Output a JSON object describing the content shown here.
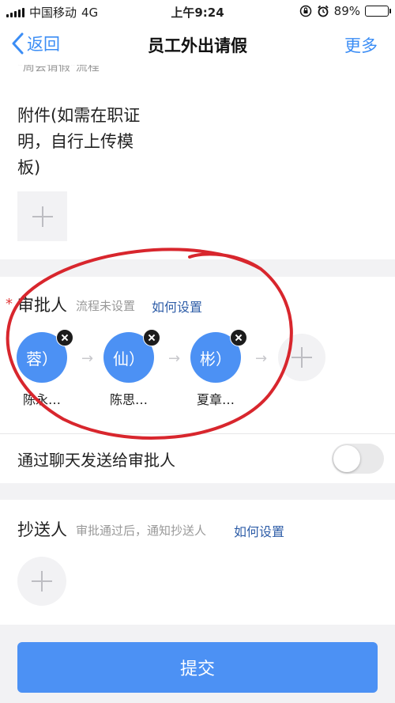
{
  "status_bar": {
    "carrier": "中国移动",
    "network": "4G",
    "time": "上午9:24",
    "battery": "89%",
    "battery_level": 0.89
  },
  "nav": {
    "back": "返回",
    "title": "员工外出请假",
    "more": "更多"
  },
  "top_note": "\"周会请假\"流程",
  "attachment": {
    "label": "附件(如需在职证明，自行上传模板)"
  },
  "approvers": {
    "title": "审批人",
    "hint": "流程未设置",
    "how_to": "如何设置",
    "people": [
      {
        "avatar": "蓉）",
        "name": "陈永…"
      },
      {
        "avatar": "仙）",
        "name": "陈思…"
      },
      {
        "avatar": "彬）",
        "name": "夏章…"
      }
    ],
    "arrow": "→"
  },
  "send_via_chat": {
    "label": "通过聊天发送给审批人",
    "enabled": false
  },
  "cc": {
    "title": "抄送人",
    "hint": "审批通过后，通知抄送人",
    "how_to": "如何设置"
  },
  "submit": "提交",
  "colors": {
    "accent": "#3b8df5",
    "avatar": "#4c91f4",
    "annotation": "#d8262d",
    "link": "#2f5ea8"
  }
}
